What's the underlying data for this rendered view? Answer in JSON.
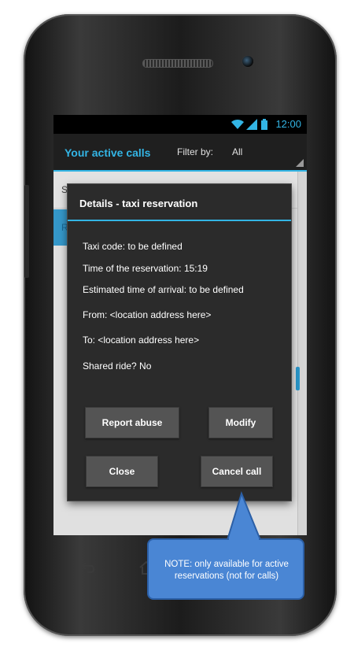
{
  "status_bar": {
    "time": "12:00",
    "icons": [
      "wifi-icon",
      "signal-icon",
      "battery-icon"
    ],
    "accent_color": "#33b5e5"
  },
  "action_bar": {
    "title": "Your active calls",
    "filter_label": "Filter by:",
    "filter_value": "All"
  },
  "list": {
    "row1_text": "S",
    "row2_text": "R"
  },
  "dialog": {
    "title": "Details - taxi reservation",
    "details": {
      "taxi_code": "Taxi code: to be defined",
      "reservation_time": "Time of the reservation: 15:19",
      "eta": "Estimated time of arrival: to be defined",
      "from": "From: <location address here>",
      "to": "To: <location address here>",
      "shared_ride": "Shared ride? No"
    },
    "buttons": {
      "report_abuse": "Report abuse",
      "modify": "Modify",
      "close": "Close",
      "cancel_call": "Cancel call"
    }
  },
  "annotation": {
    "note": "NOTE: only available for active reservations (not for calls)",
    "color": "#4a86d4"
  }
}
